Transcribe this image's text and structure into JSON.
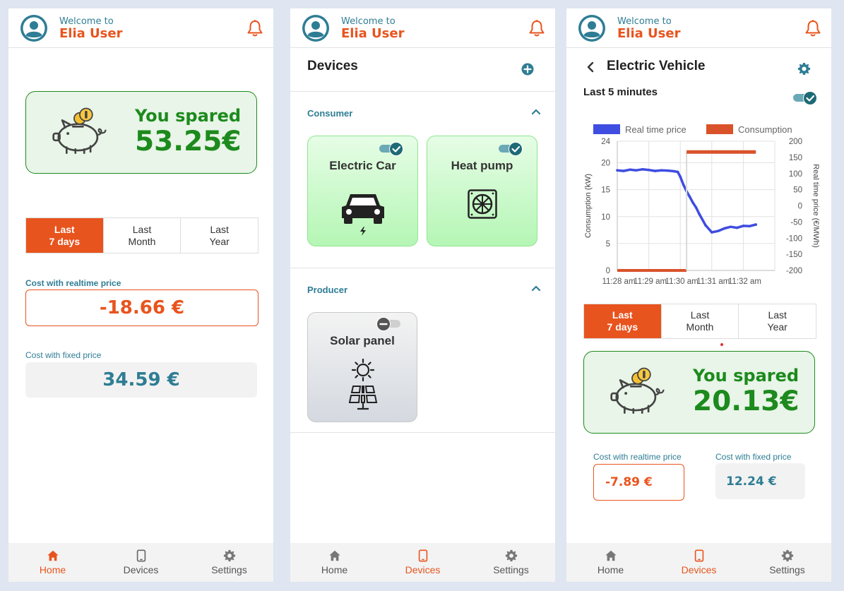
{
  "header": {
    "welcome": "Welcome to",
    "user_name": "Elia User"
  },
  "nav": [
    {
      "label": "Home",
      "icon": "home-icon"
    },
    {
      "label": "Devices",
      "icon": "tablet-icon"
    },
    {
      "label": "Settings",
      "icon": "gear-icon"
    }
  ],
  "home": {
    "spared_title": "You spared",
    "spared_value": "53.25€",
    "periods": [
      "Last\n7 days",
      "Last\nMonth",
      "Last\nYear"
    ],
    "selected_period": 0,
    "cost_realtime_label": "Cost with realtime price",
    "cost_realtime_value": "-18.66 €",
    "cost_fixed_label": "Cost with fixed price",
    "cost_fixed_value": "34.59 €"
  },
  "devices": {
    "title": "Devices",
    "consumer_label": "Consumer",
    "producer_label": "Producer",
    "consumer_items": [
      {
        "name": "Electric Car",
        "enabled": true,
        "icon": "car-icon"
      },
      {
        "name": "Heat pump",
        "enabled": true,
        "icon": "fan-icon"
      }
    ],
    "producer_items": [
      {
        "name": "Solar panel",
        "enabled": false,
        "icon": "solar-panel-icon"
      }
    ]
  },
  "vehicle": {
    "title": "Electric Vehicle",
    "range_label": "Last 5 minutes",
    "range_enabled": true,
    "periods": [
      "Last\n7 days",
      "Last\nMonth",
      "Last\nYear"
    ],
    "selected_period": 0,
    "spared_title": "You spared",
    "spared_value": "20.13€",
    "cost_realtime_label": "Cost with realtime price",
    "cost_realtime_value": "-7.89 €",
    "cost_fixed_label": "Cost with fixed price",
    "cost_fixed_value": "12.24 €"
  },
  "colors": {
    "accent_orange": "#e8541e",
    "teal": "#2e7d94",
    "green": "#1d8a1d",
    "price_line": "#3f4de0",
    "consumption_line": "#d9522a"
  },
  "chart_data": {
    "type": "line",
    "title": "",
    "legend": [
      "Real time price",
      "Consumption"
    ],
    "legend_position": "top",
    "x_ticks": [
      "11:28 am",
      "11:29 am",
      "11:30 am",
      "11:31 am",
      "11:32 am"
    ],
    "xlabel": "",
    "ylabel_left": "Consumption (kW)",
    "ylabel_right": "Real time price (€/MWh)",
    "ylim_left": [
      0,
      24
    ],
    "ylim_right": [
      -200,
      200
    ],
    "y_ticks_left": [
      "0",
      "5",
      "10",
      "15",
      "20",
      "24"
    ],
    "y_ticks_right": [
      "-200",
      "-150",
      "-100",
      "-50",
      "0",
      "50",
      "100",
      "150",
      "200"
    ],
    "grid": true,
    "series": [
      {
        "name": "Real time price",
        "axis": "right",
        "x": [
          0,
          0.2,
          0.4,
          0.6,
          0.8,
          1.0,
          1.2,
          1.4,
          1.6,
          1.8,
          1.92,
          2.0,
          2.1,
          2.2,
          2.3,
          2.4,
          2.5,
          2.6,
          2.8,
          3.0,
          3.2,
          3.4,
          3.6,
          3.8,
          4.0,
          4.2,
          4.4
        ],
        "y": [
          110,
          108,
          112,
          110,
          113,
          111,
          108,
          110,
          109,
          107,
          105,
          90,
          65,
          45,
          28,
          10,
          -5,
          -25,
          -60,
          -82,
          -78,
          -70,
          -65,
          -68,
          -62,
          -63,
          -58
        ]
      },
      {
        "name": "Consumption",
        "axis": "left",
        "x": [
          0,
          2.2,
          2.2,
          4.4
        ],
        "y": [
          0,
          0,
          22,
          22
        ]
      }
    ]
  }
}
